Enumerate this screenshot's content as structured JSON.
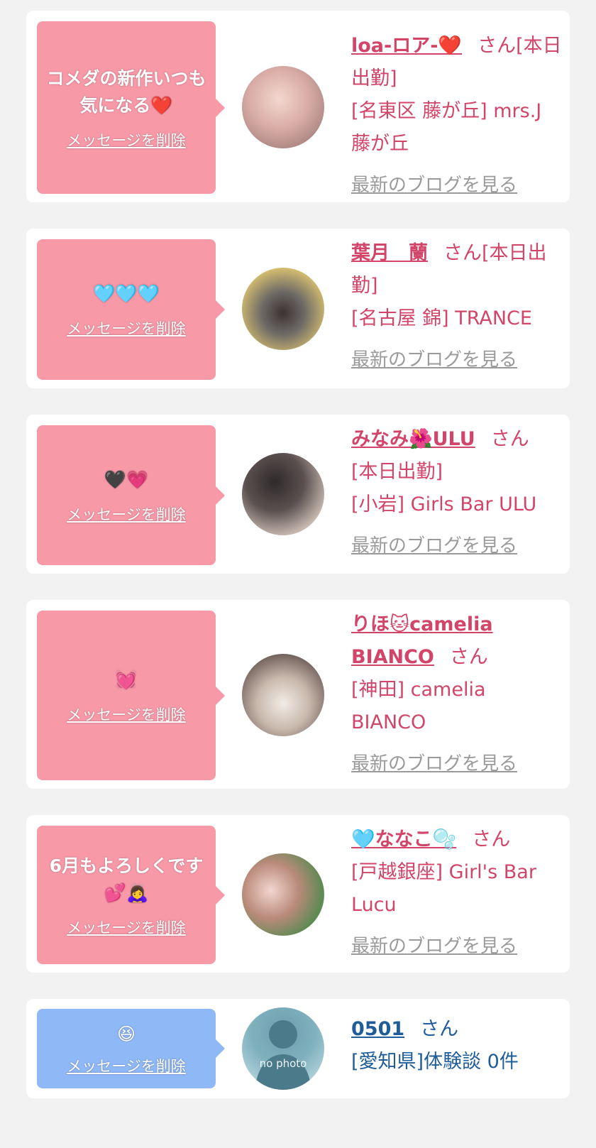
{
  "accent_pink": "#f899a8",
  "accent_blue": "#8fb8f7",
  "name_color": "#d24568",
  "entries": [
    {
      "message": "コメダの新作いつも気になる❤️",
      "delete_label": "メッセージを削除",
      "name": "loa-ロア-❤️",
      "suffix": "さん",
      "status": "[本日出勤]",
      "shop": "[名東区 藤が丘] mrs.J 藤が丘",
      "blog_label": "最新のブログを見る"
    },
    {
      "message": "🩵🩵🩵",
      "delete_label": "メッセージを削除",
      "name": "葉月　蘭",
      "suffix": "さん",
      "status": "[本日出勤]",
      "shop": "[名古屋 錦] TRANCE",
      "blog_label": "最新のブログを見る"
    },
    {
      "message": "🖤💗",
      "delete_label": "メッセージを削除",
      "name": "みなみ🌺ULU",
      "suffix": "さん",
      "status": "[本日出勤]",
      "shop": "[小岩] Girls Bar ULU",
      "blog_label": "最新のブログを見る"
    },
    {
      "message": "💓",
      "delete_label": "メッセージを削除",
      "name": "りほ🐱camelia BIANCO",
      "suffix": "さん",
      "status": "",
      "shop": "[神田] camelia BIANCO",
      "blog_label": "最新のブログを見る"
    },
    {
      "message": "6月もよろしくです💕🙇‍♀️",
      "delete_label": "メッセージを削除",
      "name": "🩵ななこ🫧",
      "suffix": "さん",
      "status": "",
      "shop": "[戸越銀座] Girl's Bar Lucu",
      "blog_label": "最新のブログを見る"
    },
    {
      "message": "😆",
      "delete_label": "メッセージを削除",
      "name": "0501",
      "suffix": "さん",
      "status": "",
      "shop": "[愛知県]体験談 0件",
      "avatar_text": "no photo"
    }
  ]
}
